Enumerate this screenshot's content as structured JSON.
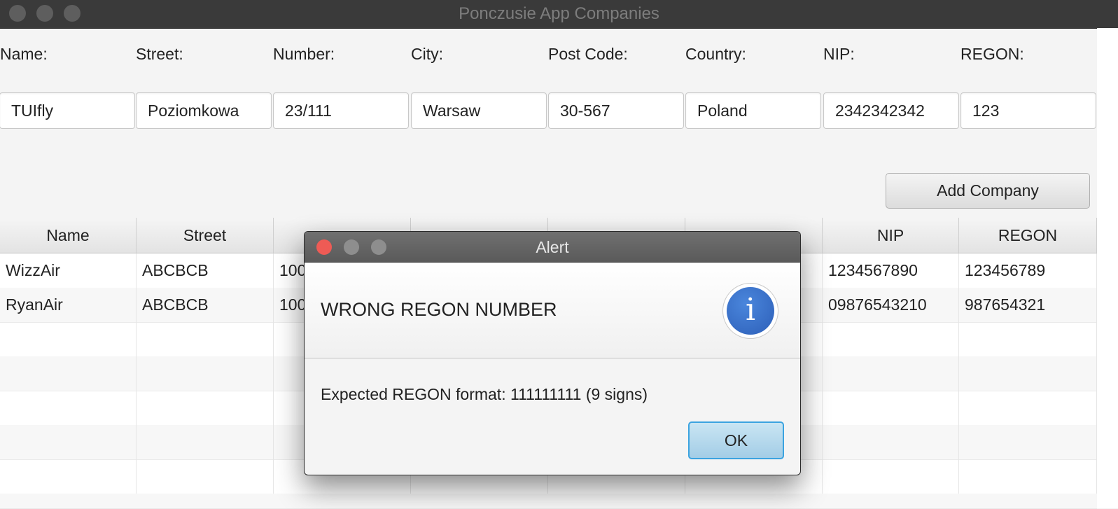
{
  "window": {
    "title": "Ponczusie App Companies"
  },
  "form": {
    "labels": [
      "Name:",
      "Street:",
      "Number:",
      "City:",
      "Post Code:",
      "Country:",
      "NIP:",
      "REGON:"
    ],
    "values": [
      "TUIfly",
      "Poziomkowa",
      "23/111",
      "Warsaw",
      "30-567",
      "Poland",
      "2342342342",
      "123"
    ],
    "add_button": "Add Company"
  },
  "table": {
    "columns": [
      "Name",
      "Street",
      "",
      "",
      "",
      "",
      "NIP",
      "REGON"
    ],
    "rows": [
      [
        "WizzAir",
        "ABCBCB",
        "100",
        "",
        "",
        "",
        "1234567890",
        "123456789"
      ],
      [
        "RyanAir",
        "ABCBCB",
        "100",
        "",
        "",
        "",
        "09876543210",
        "987654321"
      ]
    ]
  },
  "dialog": {
    "title": "Alert",
    "header": "WRONG REGON NUMBER",
    "icon": "info-icon",
    "icon_glyph": "i",
    "content": "Expected REGON format: 111111111 (9 signs)",
    "ok_button": "OK"
  },
  "colors": {
    "titlebar": "#3a3a3a",
    "close_button": "#ee5b55",
    "info_icon": "#2d5fb8",
    "ok_focus": "#3ba3e0"
  }
}
